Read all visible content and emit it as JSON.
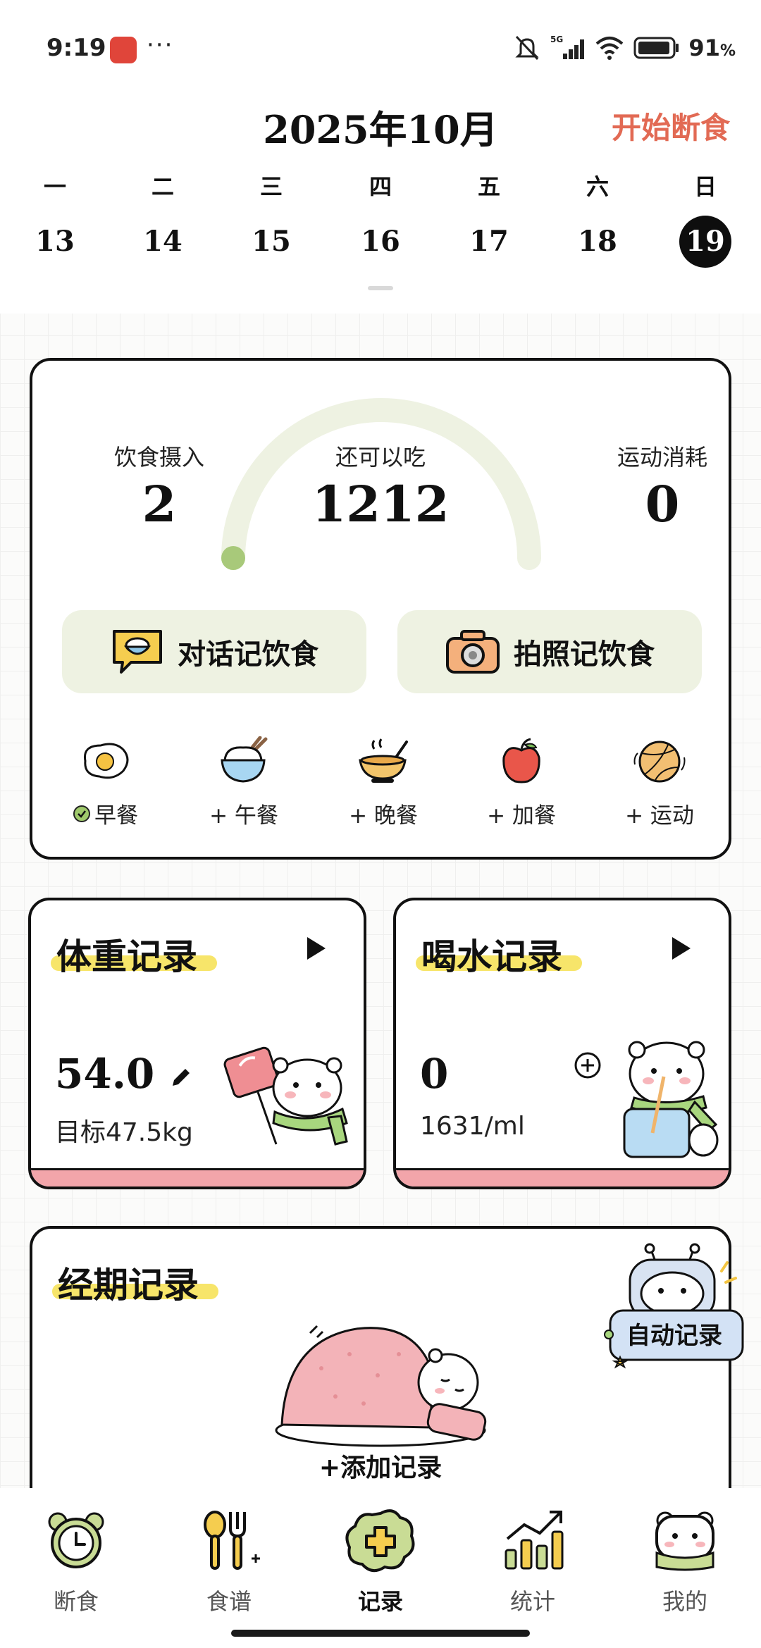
{
  "status_bar": {
    "time": "9:19",
    "dots": "···",
    "network": "5G",
    "battery": "91",
    "battery_unit": "%"
  },
  "header": {
    "month": "2025年10月",
    "start_fasting": "开始断食",
    "weekdays": [
      "一",
      "二",
      "三",
      "四",
      "五",
      "六",
      "日"
    ],
    "dates": [
      "13",
      "14",
      "15",
      "16",
      "17",
      "18",
      "19"
    ],
    "selected_index": 6
  },
  "summary": {
    "intake_label": "饮食摄入",
    "intake_value": "2",
    "remaining_label": "还可以吃",
    "remaining_value": "1212",
    "exercise_label": "运动消耗",
    "exercise_value": "0",
    "progress_fraction": 0.0,
    "chat_log_label": "对话记饮食",
    "photo_log_label": "拍照记饮食",
    "meals": [
      {
        "label": "早餐",
        "logged": true
      },
      {
        "label": "+ 午餐",
        "logged": false
      },
      {
        "label": "+ 晚餐",
        "logged": false
      },
      {
        "label": "+ 加餐",
        "logged": false
      },
      {
        "label": "+ 运动",
        "logged": false
      }
    ]
  },
  "weight_card": {
    "title": "体重记录",
    "value": "54.0",
    "target": "目标47.5kg"
  },
  "water_card": {
    "title": "喝水记录",
    "value": "0",
    "target": "1631/ml"
  },
  "period_card": {
    "title": "经期记录",
    "auto_badge": "自动记录",
    "add_record": "+添加记录"
  },
  "bottom_nav": [
    {
      "label": "断食",
      "active": false
    },
    {
      "label": "食谱",
      "active": false
    },
    {
      "label": "记录",
      "active": true
    },
    {
      "label": "统计",
      "active": false
    },
    {
      "label": "我的",
      "active": false
    }
  ],
  "colors": {
    "accent_orange": "#e26a54",
    "gauge_track": "#eef2e2",
    "gauge_dot": "#a8c97a",
    "card_green": "#eef2e2",
    "pink": "#f2a5aa",
    "highlight_yellow": "#f7e56a"
  }
}
